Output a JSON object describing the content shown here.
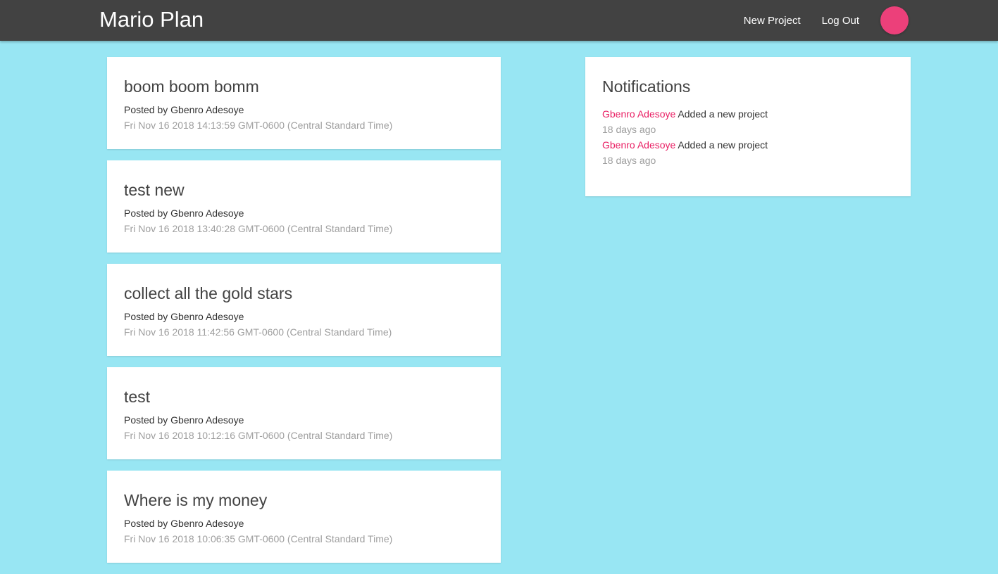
{
  "navbar": {
    "brand": "Mario Plan",
    "links": [
      "New Project",
      "Log Out"
    ],
    "avatar_color": "#ec407a",
    "background": "#424242"
  },
  "projects": [
    {
      "title": "boom boom bomm",
      "author": "Posted by Gbenro Adesoye",
      "date": "Fri Nov 16 2018 14:13:59 GMT-0600 (Central Standard Time)"
    },
    {
      "title": "test new",
      "author": "Posted by Gbenro Adesoye",
      "date": "Fri Nov 16 2018 13:40:28 GMT-0600 (Central Standard Time)"
    },
    {
      "title": "collect all the gold stars",
      "author": "Posted by Gbenro Adesoye",
      "date": "Fri Nov 16 2018 11:42:56 GMT-0600 (Central Standard Time)"
    },
    {
      "title": "test",
      "author": "Posted by Gbenro Adesoye",
      "date": "Fri Nov 16 2018 10:12:16 GMT-0600 (Central Standard Time)"
    },
    {
      "title": "Where is my money",
      "author": "Posted by Gbenro Adesoye",
      "date": "Fri Nov 16 2018 10:06:35 GMT-0600 (Central Standard Time)"
    }
  ],
  "notifications": {
    "title": "Notifications",
    "items": [
      {
        "user": "Gbenro Adesoye",
        "content": "Added a new project",
        "time": "18 days ago"
      },
      {
        "user": "Gbenro Adesoye",
        "content": "Added a new project",
        "time": "18 days ago"
      }
    ]
  },
  "colors": {
    "page_background": "#98e6f3",
    "accent": "#e91e63"
  }
}
